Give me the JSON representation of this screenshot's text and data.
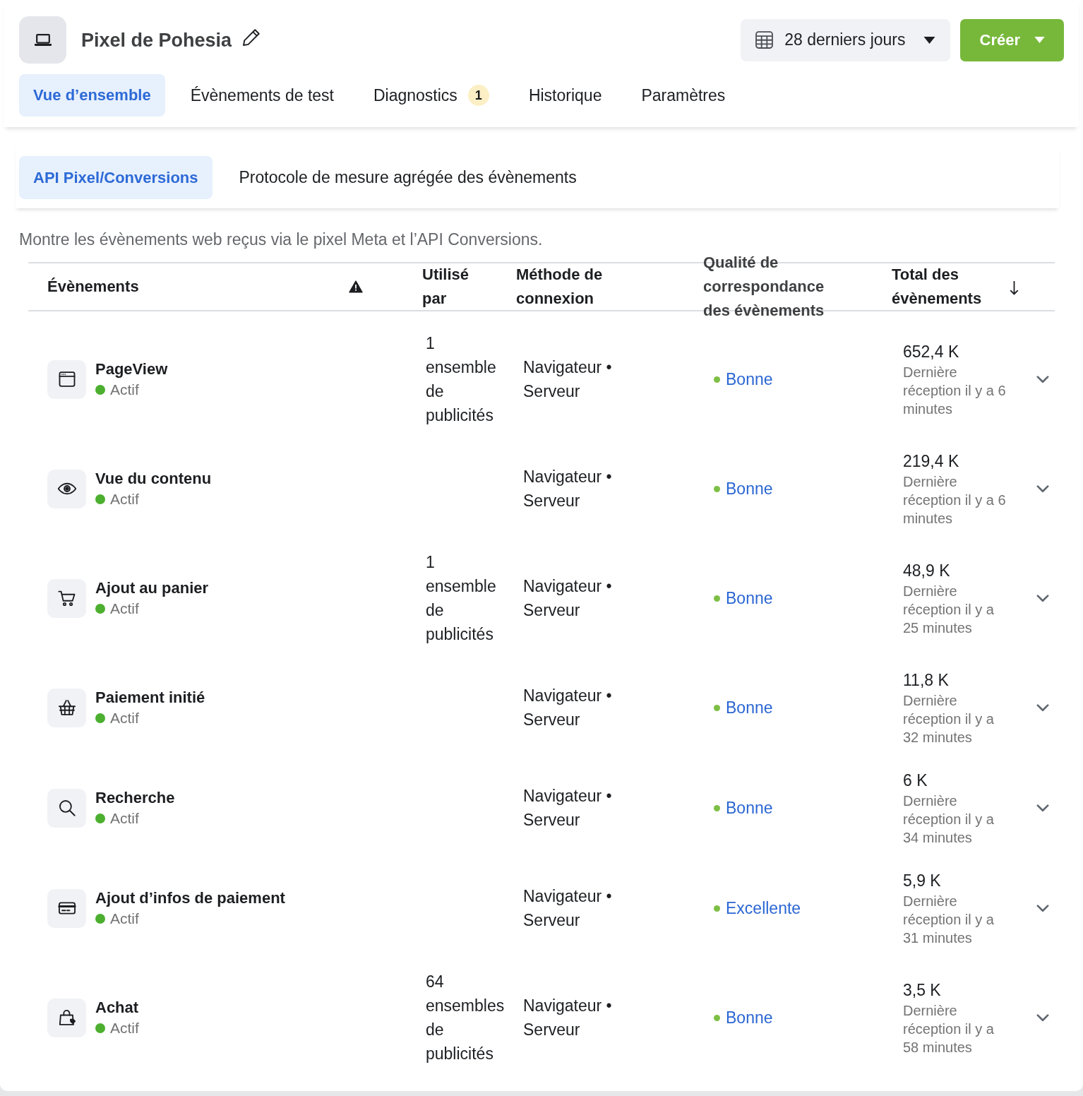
{
  "header": {
    "title": "Pixel de Pohesia",
    "date_range": "28 derniers jours",
    "create_button": "Créer"
  },
  "tabs": [
    {
      "label": "Vue d’ensemble",
      "selected": true
    },
    {
      "label": "Évènements de test",
      "selected": false
    },
    {
      "label": "Diagnostics",
      "selected": false,
      "badge": "1"
    },
    {
      "label": "Historique",
      "selected": false
    },
    {
      "label": "Paramètres",
      "selected": false
    }
  ],
  "subtabs": [
    {
      "label": "API Pixel/Conversions",
      "selected": true
    },
    {
      "label": "Protocole de mesure agrégée des évènements",
      "selected": false
    }
  ],
  "description": "Montre les évènements web reçus via le pixel Meta et l’API Conversions.",
  "table": {
    "columns": [
      {
        "label": "Évènements",
        "sorted": false
      },
      {
        "label": "Utilisé par",
        "sorted": false
      },
      {
        "label": "Méthode de connexion",
        "sorted": false
      },
      {
        "label": "Qualité de correspondance des évènements",
        "sorted": false
      },
      {
        "label": "Total des évènements",
        "sorted": true
      }
    ],
    "rows": [
      {
        "kind": "page",
        "name": "PageView",
        "status": "Actif",
        "used_by": "1 ensemble de publicités",
        "method": "Navigateur • Serveur",
        "quality": "Bonne",
        "total": "652,4 K",
        "last_received": "Dernière réception il y a 6 minutes"
      },
      {
        "kind": "view",
        "name": "Vue du contenu",
        "status": "Actif",
        "method": "Navigateur • Serveur",
        "quality": "Bonne",
        "total": "219,4 K",
        "last_received": "Dernière réception il y a 6 minutes"
      },
      {
        "kind": "cart",
        "name": "Ajout au panier",
        "status": "Actif",
        "used_by": "1 ensemble de publicités",
        "method": "Navigateur • Serveur",
        "quality": "Bonne",
        "total": "48,9 K",
        "last_received": "Dernière réception il y a 25 minutes"
      },
      {
        "kind": "checkout",
        "name": "Paiement initié",
        "status": "Actif",
        "method": "Navigateur • Serveur",
        "quality": "Bonne",
        "total": "11,8 K",
        "last_received": "Dernière réception il y a 32 minutes"
      },
      {
        "kind": "search",
        "name": "Recherche",
        "status": "Actif",
        "method": "Navigateur • Serveur",
        "quality": "Bonne",
        "total": "6 K",
        "last_received": "Dernière réception il y a 34 minutes"
      },
      {
        "kind": "payment",
        "name": "Ajout d’infos de paiement",
        "status": "Actif",
        "method": "Navigateur • Serveur",
        "quality": "Excellente",
        "total": "5,9 K",
        "last_received": "Dernière réception il y a 31 minutes"
      },
      {
        "kind": "purchase",
        "name": "Achat",
        "status": "Actif",
        "used_by": "64 ensembles de publicités",
        "method": "Navigateur • Serveur",
        "quality": "Bonne",
        "total": "3,5 K",
        "last_received": "Dernière réception il y a 58 minutes"
      }
    ]
  }
}
